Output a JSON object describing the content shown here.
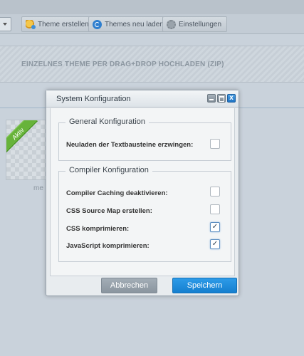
{
  "toolbar": {
    "create_theme": "Theme erstellen",
    "reload_themes": "Themes neu laden",
    "settings": "Einstellungen"
  },
  "upload": {
    "label": "EINZELNES THEME PER DRAG+DROP HOCHLADEN (ZIP)"
  },
  "theme_card": {
    "badge": "Aktiv",
    "caption": "me"
  },
  "dialog": {
    "title": "System Konfiguration",
    "close_symbol": "x",
    "general": {
      "legend": "General Konfiguration",
      "rows": [
        {
          "label": "Neuladen der Textbausteine erzwingen:",
          "checked": false
        }
      ]
    },
    "compiler": {
      "legend": "Compiler Konfiguration",
      "rows": [
        {
          "label": "Compiler Caching deaktivieren:",
          "checked": false
        },
        {
          "label": "CSS Source Map erstellen:",
          "checked": false
        },
        {
          "label": "CSS komprimieren:",
          "checked": true
        },
        {
          "label": "JavaScript komprimieren:",
          "checked": true
        }
      ]
    },
    "buttons": {
      "cancel": "Abbrechen",
      "save": "Speichern"
    }
  },
  "colors": {
    "accent": "#1f8ae0",
    "active_badge": "#67b33a"
  }
}
